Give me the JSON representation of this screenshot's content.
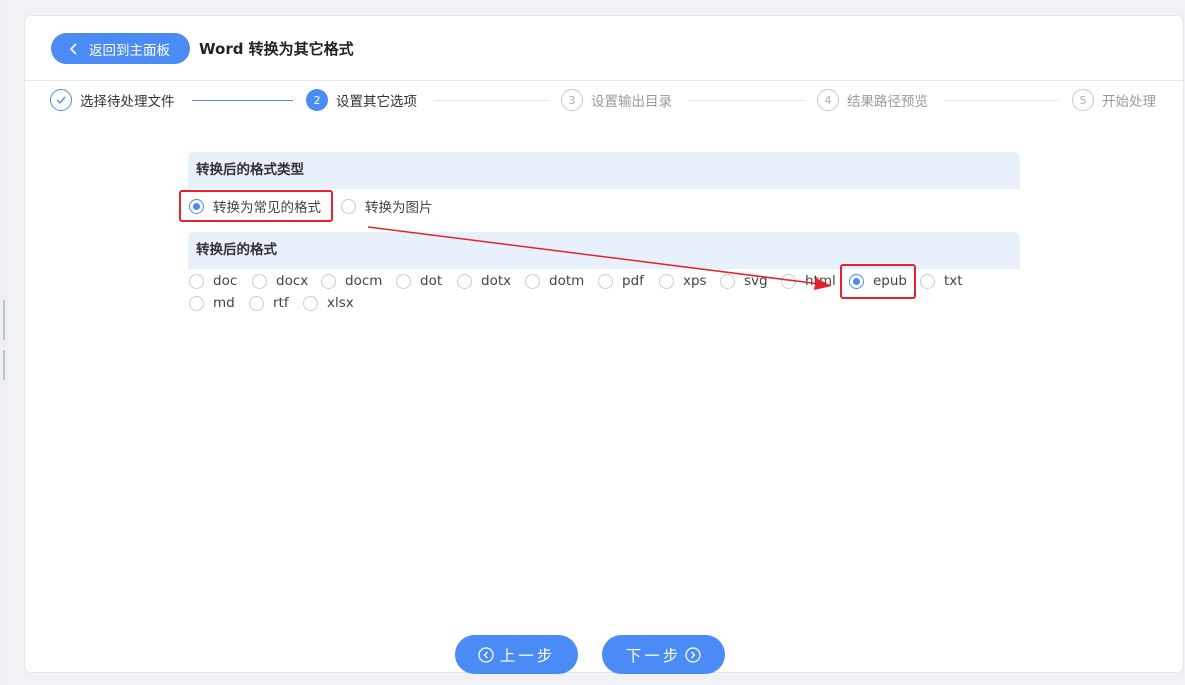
{
  "header": {
    "back_label": "返回到主面板",
    "title": "Word 转换为其它格式"
  },
  "steps": [
    {
      "index": "1",
      "label": "选择待处理文件",
      "state": "done"
    },
    {
      "index": "2",
      "label": "设置其它选项",
      "state": "active"
    },
    {
      "index": "3",
      "label": "设置输出目录",
      "state": "pending"
    },
    {
      "index": "4",
      "label": "结果路径预览",
      "state": "pending"
    },
    {
      "index": "5",
      "label": "开始处理",
      "state": "pending"
    }
  ],
  "format_type": {
    "heading": "转换后的格式类型",
    "options": [
      "转换为常见的格式",
      "转换为图片"
    ],
    "selected": "转换为常见的格式"
  },
  "format": {
    "heading": "转换后的格式",
    "options": [
      "doc",
      "docx",
      "docm",
      "dot",
      "dotx",
      "dotm",
      "pdf",
      "xps",
      "svg",
      "html",
      "epub",
      "txt",
      "md",
      "rtf",
      "xlsx"
    ],
    "selected": "epub"
  },
  "footer": {
    "prev_label": "上一步",
    "next_label": "下一步"
  },
  "colors": {
    "accent": "#4b8bf5",
    "highlight": "#e5232c",
    "section_bg": "#e8f0fc"
  }
}
